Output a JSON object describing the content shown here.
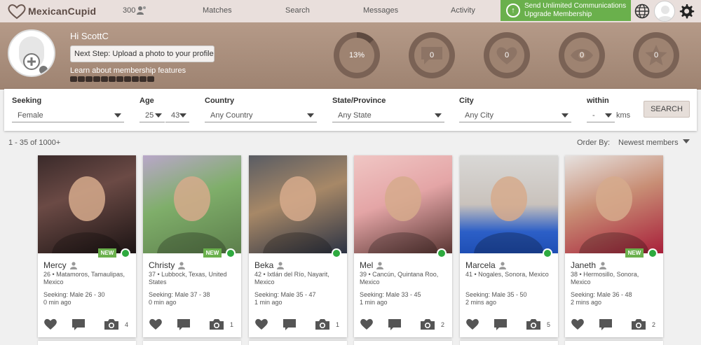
{
  "nav": {
    "logo_text": "MexicanCupid",
    "online_count": "300",
    "items": [
      "Matches",
      "Search",
      "Messages",
      "Activity"
    ],
    "upgrade_line1": "Send Unlimited Communications",
    "upgrade_line2": "Upgrade Membership"
  },
  "header": {
    "greeting": "Hi ScottC",
    "next_step": "Next Step: Upload a photo to your profile",
    "learn": "Learn about membership features",
    "stats": [
      "13%",
      "0",
      "0",
      "0",
      "0"
    ]
  },
  "filters": {
    "seeking_label": "Seeking",
    "seeking_value": "Female",
    "age_label": "Age",
    "age_min": "25",
    "age_max": "43",
    "country_label": "Country",
    "country_value": "Any Country",
    "state_label": "State/Province",
    "state_value": "Any State",
    "city_label": "City",
    "city_value": "Any City",
    "within_label": "within",
    "within_value": "-",
    "kms": "kms",
    "search_label": "SEARCH"
  },
  "results": {
    "count": "1 - 35 of 1000+",
    "order_label": "Order By:",
    "order_value": "Newest members"
  },
  "colors": {
    "accent_green": "#6ab04c",
    "band": "#9e8371",
    "online": "#2eaa3f"
  },
  "profiles": [
    {
      "name": "Mercy",
      "loc": "26 • Matamoros, Tamaulipas, Mexico",
      "seeking": "Seeking: Male 26 - 30",
      "ago": "0 min ago",
      "photos": "4",
      "is_new": "NEW"
    },
    {
      "name": "Christy",
      "loc": "37 • Lubbock, Texas, United States",
      "seeking": "Seeking: Male 37 - 38",
      "ago": "0 min ago",
      "photos": "1",
      "is_new": "NEW"
    },
    {
      "name": "Beka",
      "loc": "42 • Ixtlán del Río, Nayarit, Mexico",
      "seeking": "Seeking: Male 35 - 47",
      "ago": "1 min ago",
      "photos": "1",
      "is_new": ""
    },
    {
      "name": "Mel",
      "loc": "39 • Cancún, Quintana Roo, Mexico",
      "seeking": "Seeking: Male 33 - 45",
      "ago": "1 min ago",
      "photos": "2",
      "is_new": ""
    },
    {
      "name": "Marcela",
      "loc": "41 • Nogales, Sonora, Mexico",
      "seeking": "Seeking: Male 35 - 50",
      "ago": "2 mins ago",
      "photos": "5",
      "is_new": ""
    },
    {
      "name": "Janeth",
      "loc": "38 • Hermosillo, Sonora, Mexico",
      "seeking": "Seeking: Male 36 - 48",
      "ago": "2 mins ago",
      "photos": "2",
      "is_new": "NEW"
    }
  ]
}
